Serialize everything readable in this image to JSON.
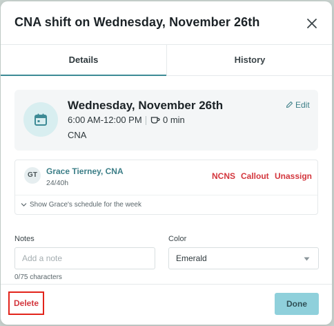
{
  "modal": {
    "title": "CNA shift on Wednesday, November 26th"
  },
  "tabs": [
    {
      "label": "Details",
      "active": true
    },
    {
      "label": "History",
      "active": false
    }
  ],
  "shift": {
    "day": "Wednesday, November 26th",
    "time": "6:00 AM-12:00 PM",
    "break": "0 min",
    "role": "CNA",
    "edit_label": "Edit",
    "icon": "calendar-icon"
  },
  "assignee": {
    "initials": "GT",
    "name": "Grace Tierney, CNA",
    "hours": "24/40h",
    "actions": [
      "NCNS",
      "Callout",
      "Unassign"
    ],
    "schedule_link": "Show Grace's schedule for the week"
  },
  "notes": {
    "label": "Notes",
    "placeholder": "Add a note",
    "value": "",
    "count": "0/75 characters"
  },
  "color": {
    "label": "Color",
    "selected": "Emerald"
  },
  "footer": {
    "delete_label": "Delete",
    "done_label": "Done"
  },
  "colors": {
    "accent": "#3c8a95",
    "danger": "#d3363d",
    "done_button": "#8fd0db",
    "highlight_box": "#e2231a"
  }
}
